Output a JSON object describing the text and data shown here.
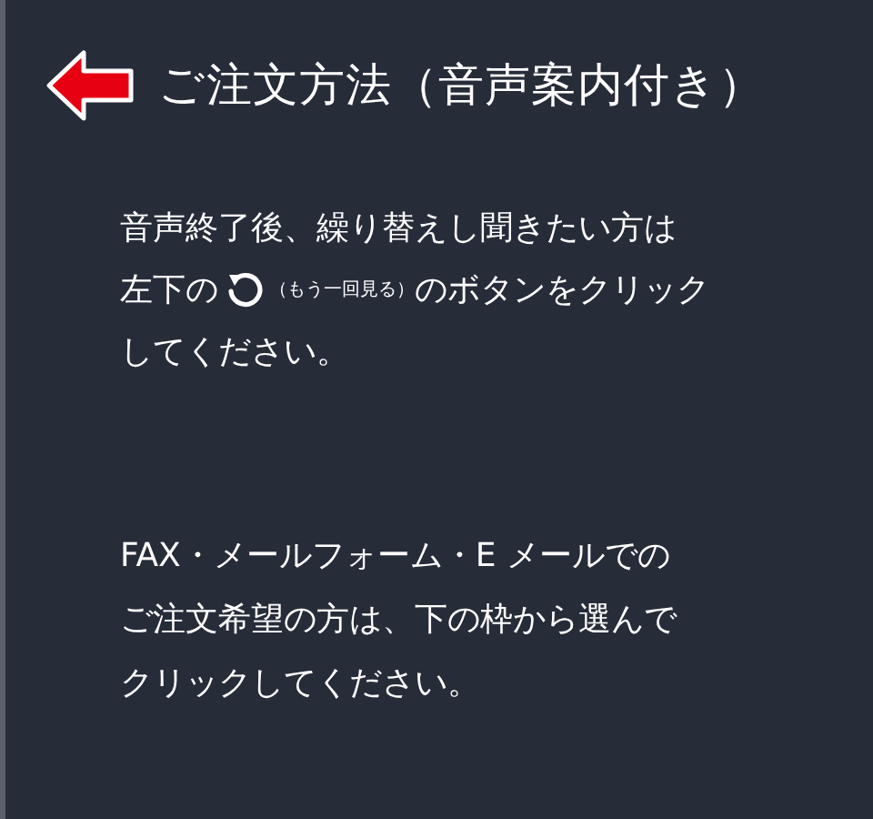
{
  "header": {
    "title": "ご注文方法（音声案内付き）"
  },
  "replay_instructions": [
    {
      "kind": "text",
      "text": "音声終了後、繰り替えし聞きたい方は"
    },
    {
      "kind": "replay",
      "before": "左下の",
      "note": "（もう一回見る）",
      "after": "のボタンをクリック"
    },
    {
      "kind": "text",
      "text": "してください。"
    }
  ],
  "order_instructions": [
    {
      "kind": "text",
      "text": "FAX・メールフォーム・E メールでの"
    },
    {
      "kind": "text",
      "text": "ご注文希望の方は、下の枠から選んで"
    },
    {
      "kind": "text",
      "text": "クリックしてください。"
    }
  ]
}
